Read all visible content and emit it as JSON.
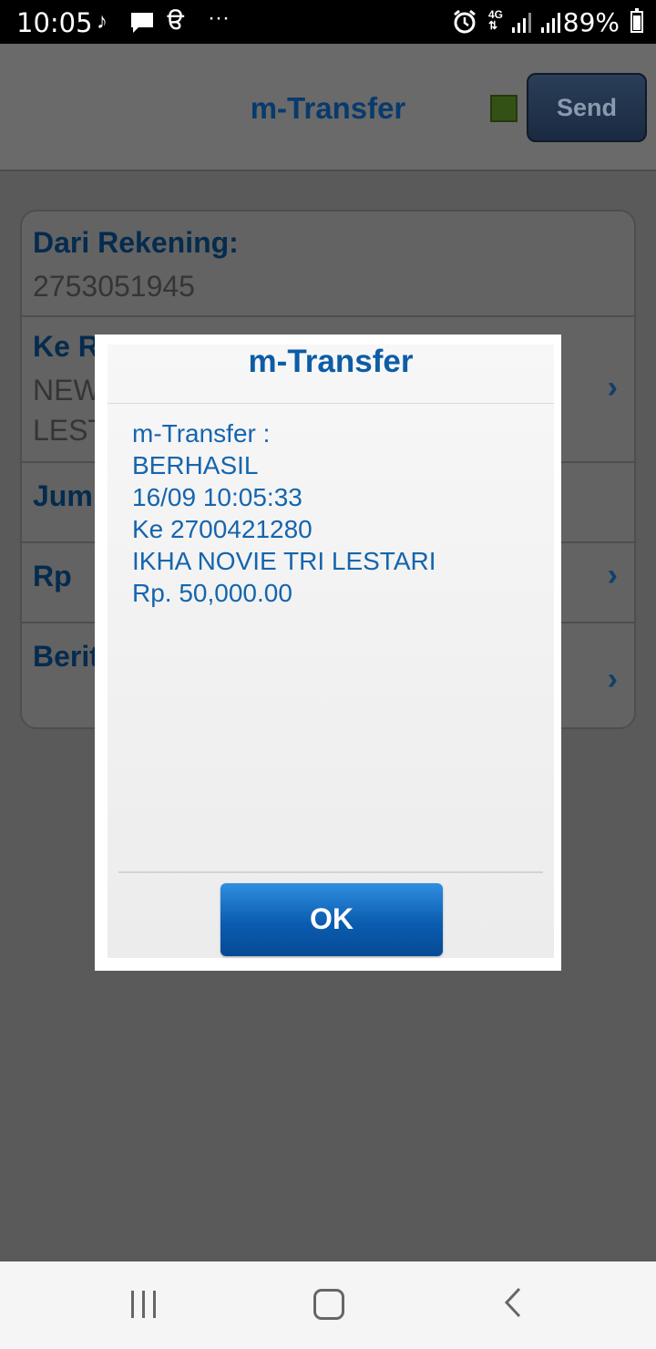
{
  "status_bar": {
    "time": "10:05",
    "network": "4G",
    "battery": "89%",
    "battery_level": 0.89,
    "icons": [
      "tiktok-icon",
      "message-icon",
      "app-icon",
      "more-icon",
      "alarm-icon",
      "signal-icon",
      "signal-icon",
      "battery-icon"
    ]
  },
  "app_bar": {
    "title": "m-Transfer",
    "send_label": "Send",
    "status_color": "#5a8a1e"
  },
  "form": {
    "from_label": "Dari Rekening:",
    "from_value": "2753051945",
    "to_label": "Ke R",
    "to_value_line1": "NEW",
    "to_value_line2": "LEST",
    "amount_label": "Jum",
    "currency_label": "Rp",
    "message_label": "Berit"
  },
  "dialog": {
    "title": "m-Transfer",
    "lines": [
      "m-Transfer :",
      "BERHASIL",
      "16/09 10:05:33",
      "Ke 2700421280",
      "IKHA NOVIE TRI LESTARI",
      "Rp. 50,000.00"
    ],
    "ok_label": "OK"
  },
  "colors": {
    "accent": "#0c5da5",
    "overlay": "#5a5a5a",
    "button": "#0b5cb0"
  }
}
